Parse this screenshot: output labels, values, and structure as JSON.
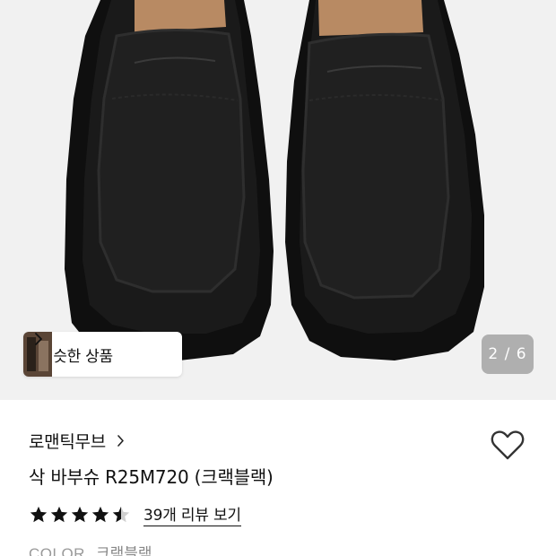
{
  "hero": {
    "image_alt": "black leather loafers",
    "similar_products_label": "비슷한 상품",
    "pager_current": "2",
    "pager_total": "6",
    "pager_text": "2 / 6"
  },
  "product": {
    "brand": "로맨틱무브",
    "title": "삭 바부슈 R25M720 (크랙블랙)",
    "rating": 4.5,
    "rating_max": 5,
    "review_link": "39개 리뷰 보기",
    "color_label": "COLOR",
    "color_value": "크랙블랙"
  },
  "icons": {
    "similar_chevron": "chevron-right-icon",
    "brand_chevron": "chevron-right-icon",
    "wishlist": "heart-outline-icon",
    "star": "star-icon"
  },
  "colors": {
    "hero_bg": "#f1f1f1",
    "shoe": "#141414",
    "pager_bg": "#8a8a8a",
    "star": "#111111"
  }
}
